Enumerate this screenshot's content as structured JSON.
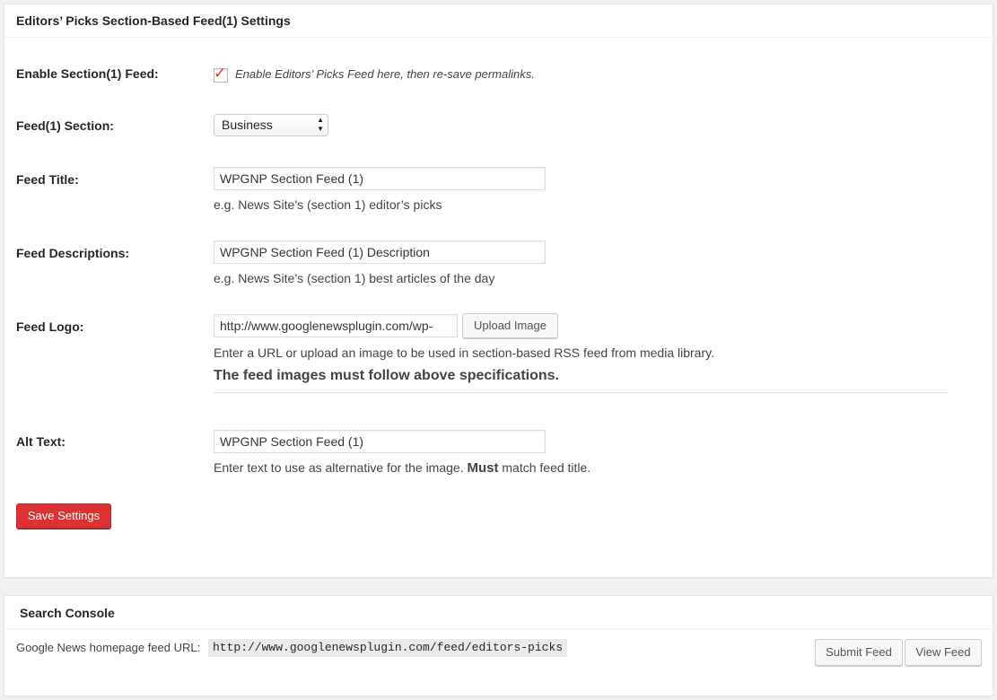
{
  "settings": {
    "title": "Editors’ Picks Section-Based Feed(1) Settings",
    "enable": {
      "label": "Enable Section(1) Feed:",
      "checked": true,
      "description": "Enable Editors’ Picks Feed here, then re-save permalinks."
    },
    "section": {
      "label": "Feed(1) Section:",
      "selected": "Business"
    },
    "feed_title": {
      "label": "Feed Title:",
      "value": "WPGNP Section Feed (1)",
      "hint": "e.g. News Site’s (section 1) editor’s picks"
    },
    "feed_descriptions": {
      "label": "Feed Descriptions:",
      "value": "WPGNP Section Feed (1) Description",
      "hint": "e.g. News Site’s (section 1) best articles of the day"
    },
    "feed_logo": {
      "label": "Feed Logo:",
      "value": "http://www.googlenewsplugin.com/wp-",
      "upload_label": "Upload Image",
      "hint": "Enter a URL or upload an image to be used in section-based RSS feed from media library.",
      "spec_note": "The feed images must follow above specifications."
    },
    "alt_text": {
      "label": "Alt Text:",
      "value": "WPGNP Section Feed (1)",
      "hint_before": "Enter text to use as alternative for the image. ",
      "hint_strong": "Must",
      "hint_after": " match feed title."
    },
    "save_label": "Save Settings"
  },
  "console": {
    "title": "Search Console",
    "url_label": "Google News homepage feed URL:",
    "url_value": "http://www.googlenewsplugin.com/feed/editors-picks",
    "submit_label": "Submit Feed",
    "view_label": "View Feed"
  },
  "colors": {
    "accent_red": "#dc3232",
    "panel_bg": "#ffffff",
    "page_bg": "#f1f1f1"
  }
}
